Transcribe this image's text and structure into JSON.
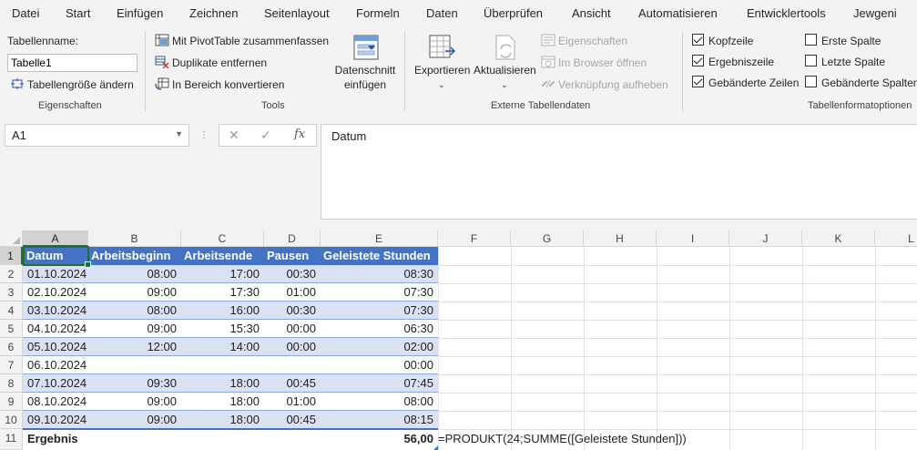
{
  "menu": {
    "tabs": [
      "Datei",
      "Start",
      "Einfügen",
      "Zeichnen",
      "Seitenlayout",
      "Formeln",
      "Daten",
      "Überprüfen",
      "Ansicht",
      "Automatisieren",
      "Entwicklertools",
      "Jewgeni"
    ]
  },
  "ribbon": {
    "properties": {
      "table_name_label": "Tabellenname:",
      "table_name_value": "Tabelle1",
      "resize_label": "Tabellengröße ändern",
      "group_label": "Eigenschaften"
    },
    "tools": {
      "pivot_label": "Mit PivotTable zusammenfassen",
      "remove_duplicates_label": "Duplikate entfernen",
      "convert_range_label": "In Bereich konvertieren",
      "slicer_label_line1": "Datenschnitt",
      "slicer_label_line2": "einfügen",
      "group_label": "Tools"
    },
    "external": {
      "export_label": "Exportieren",
      "refresh_label": "Aktualisieren",
      "properties_label": "Eigenschaften",
      "browser_label": "Im Browser öffnen",
      "unlink_label": "Verknüpfung aufheben",
      "group_label": "Externe Tabellendaten"
    },
    "style_options": {
      "header_row_label": "Kopfzeile",
      "total_row_label": "Ergebniszeile",
      "banded_rows_label": "Gebänderte Zeilen",
      "first_column_label": "Erste Spalte",
      "last_column_label": "Letzte Spalte",
      "banded_columns_label": "Gebänderte Spalten",
      "group_label": "Tabellenformatoptionen"
    }
  },
  "formula_bar": {
    "name_box": "A1",
    "formula": "Datum"
  },
  "grid": {
    "columns": [
      "A",
      "B",
      "C",
      "D",
      "E",
      "F",
      "G",
      "H",
      "I",
      "J",
      "K",
      "L"
    ],
    "rows": [
      "1",
      "2",
      "3",
      "4",
      "5",
      "6",
      "7",
      "8",
      "9",
      "10",
      "11"
    ],
    "table_headers": [
      "Datum",
      "Arbeitsbeginn",
      "Arbeitsende",
      "Pausen",
      "Geleistete Stunden"
    ],
    "table_rows": [
      [
        "01.10.2024",
        "08:00",
        "17:00",
        "00:30",
        "08:30"
      ],
      [
        "02.10.2024",
        "09:00",
        "17:30",
        "01:00",
        "07:30"
      ],
      [
        "03.10.2024",
        "08:00",
        "16:00",
        "00:30",
        "07:30"
      ],
      [
        "04.10.2024",
        "09:00",
        "15:30",
        "00:00",
        "06:30"
      ],
      [
        "05.10.2024",
        "12:00",
        "14:00",
        "00:00",
        "02:00"
      ],
      [
        "06.10.2024",
        "",
        "",
        "",
        "00:00"
      ],
      [
        "07.10.2024",
        "09:30",
        "18:00",
        "00:45",
        "07:45"
      ],
      [
        "08.10.2024",
        "09:00",
        "18:00",
        "01:00",
        "08:00"
      ],
      [
        "09.10.2024",
        "09:00",
        "18:00",
        "00:45",
        "08:15"
      ]
    ],
    "total_label": "Ergebnis",
    "total_value": "56,00",
    "formula_text": "=PRODUKT(24;SUMME([Geleistete Stunden]))"
  },
  "colors": {
    "table_header": "#4472c4",
    "band": "#d9e1f2",
    "selection": "#1e6f3a"
  }
}
